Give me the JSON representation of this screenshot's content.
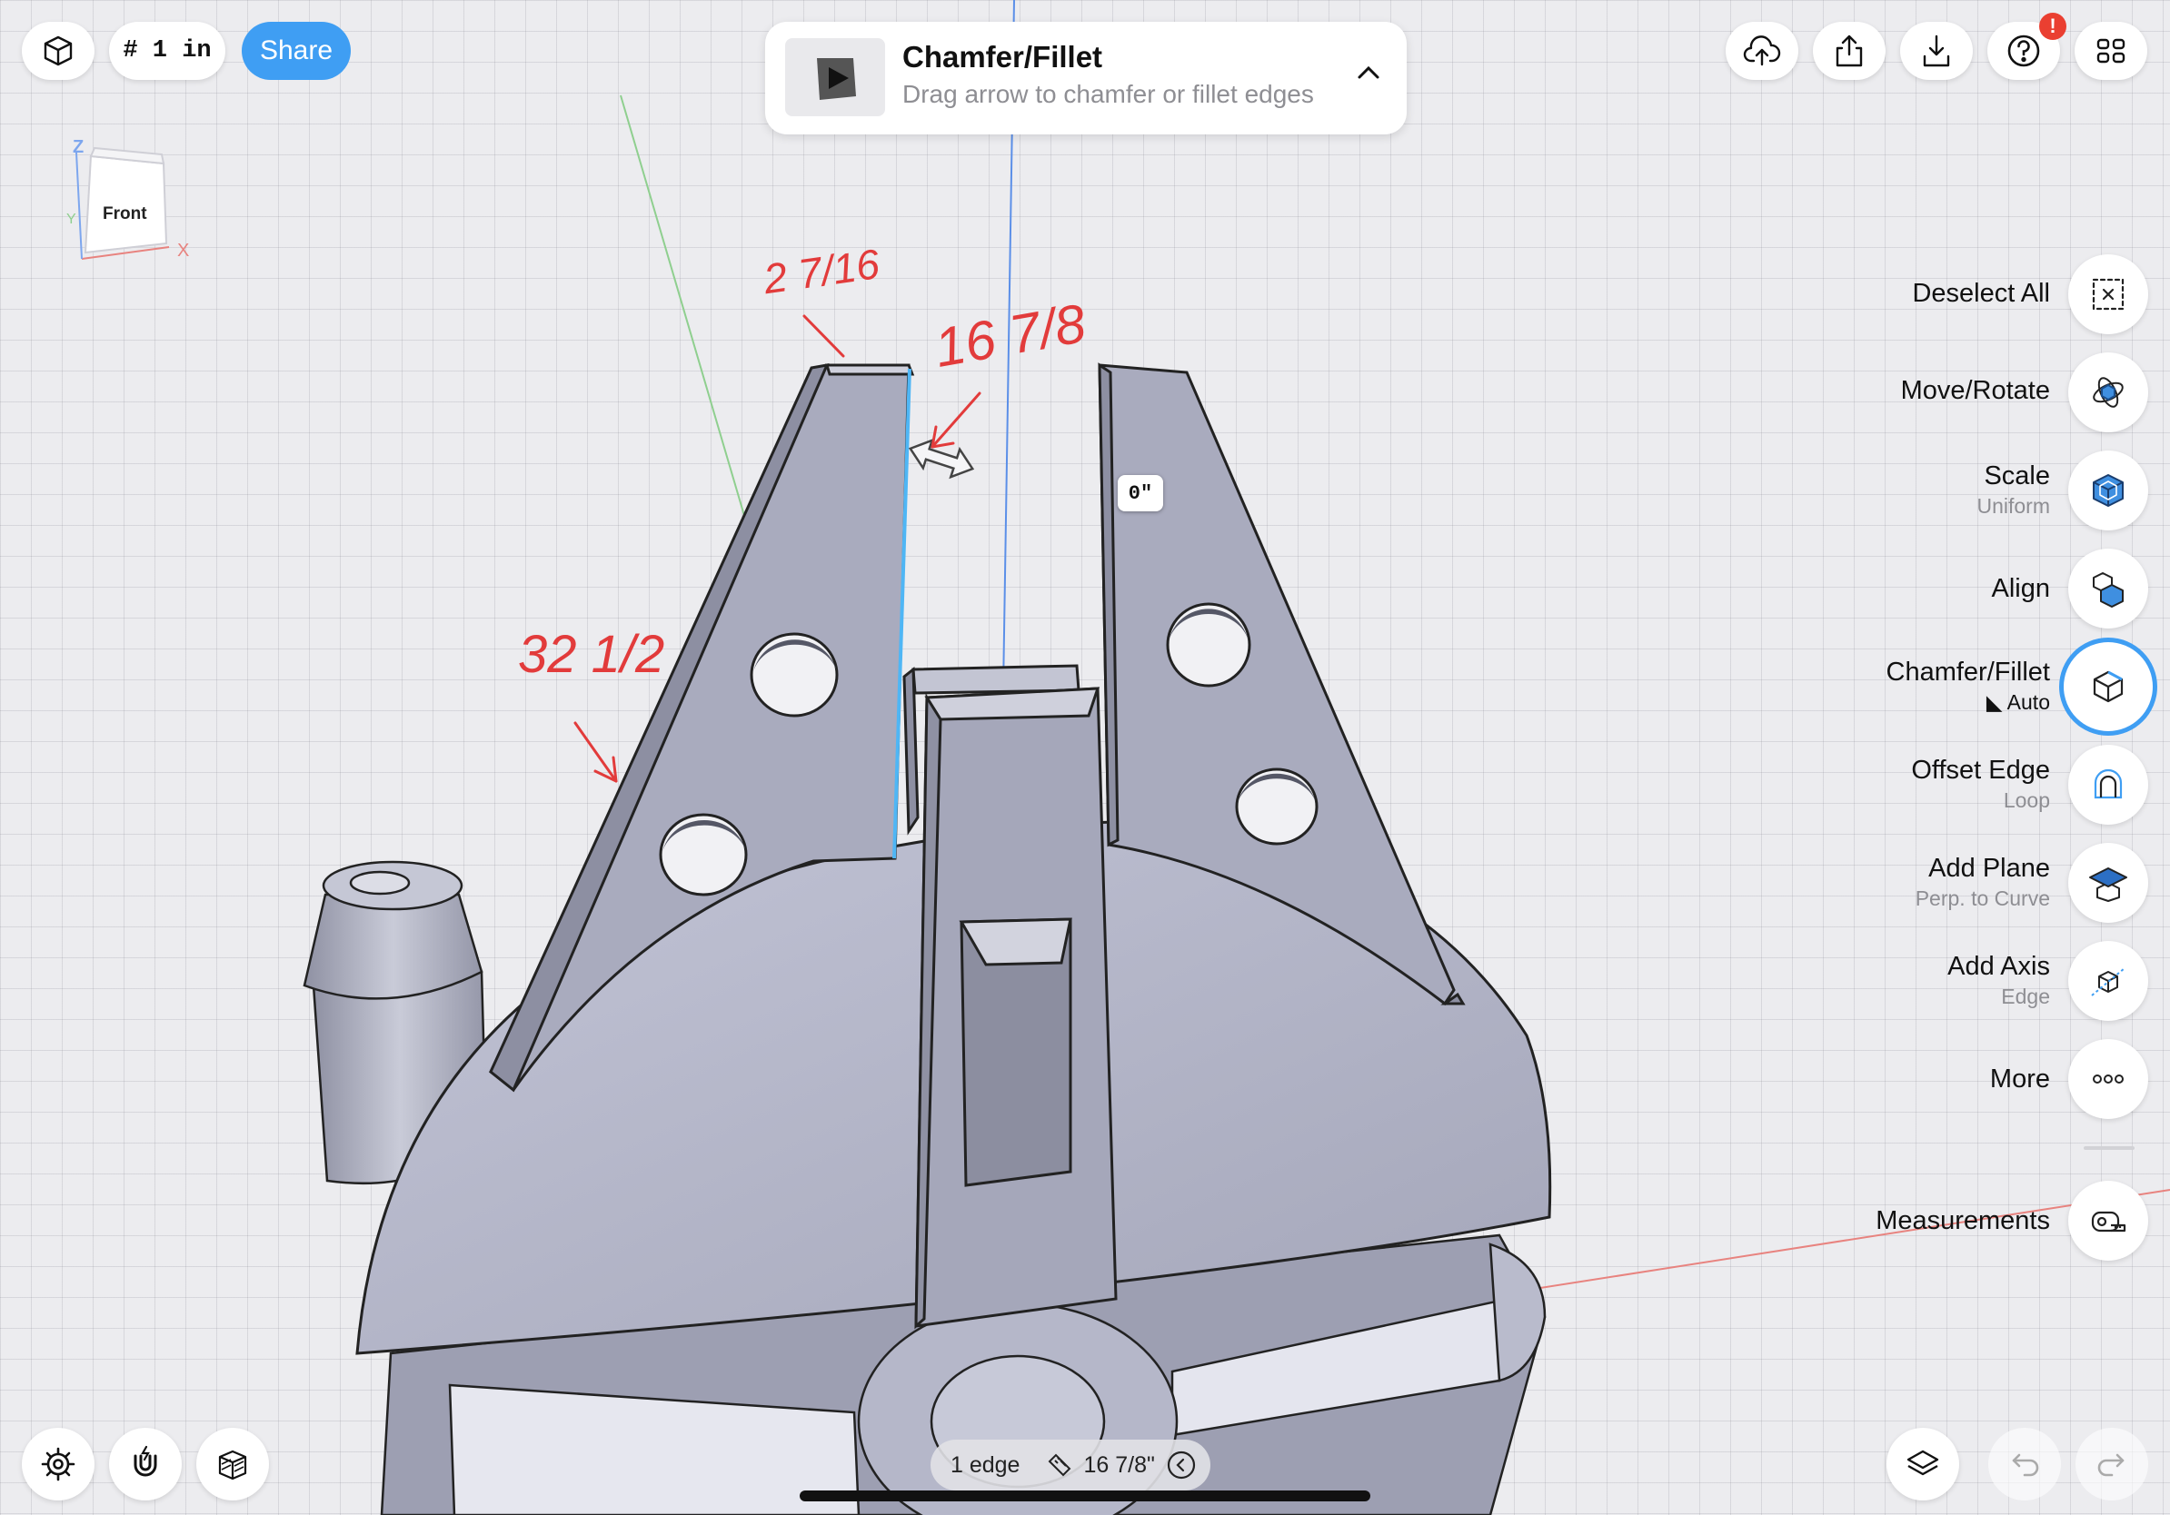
{
  "toolbar": {
    "units_label": "# 1 in",
    "share_label": "Share",
    "notification_badge": "!"
  },
  "banner": {
    "title": "Chamfer/Fillet",
    "subtitle": "Drag arrow to chamfer or fillet edges"
  },
  "nav_cube": {
    "face": "Front",
    "axis_z": "Z",
    "axis_x": "X",
    "axis_y": "Y"
  },
  "annotations": [
    "2 7/16",
    "16 7/8",
    "32 1/2"
  ],
  "viewport": {
    "chamfer_value": "0\""
  },
  "tools": [
    {
      "label": "Deselect All",
      "sub": "",
      "icon": "deselect-icon"
    },
    {
      "label": "Move/Rotate",
      "sub": "",
      "icon": "move-rotate-icon"
    },
    {
      "label": "Scale",
      "sub": "Uniform",
      "icon": "scale-cube-icon"
    },
    {
      "label": "Align",
      "sub": "",
      "icon": "align-icon"
    },
    {
      "label": "Chamfer/Fillet",
      "sub": "Auto",
      "icon": "chamfer-icon"
    },
    {
      "label": "Offset Edge",
      "sub": "Loop",
      "icon": "offset-edge-icon"
    },
    {
      "label": "Add Plane",
      "sub": "Perp. to Curve",
      "icon": "add-plane-icon"
    },
    {
      "label": "Add Axis",
      "sub": "Edge",
      "icon": "add-axis-icon"
    },
    {
      "label": "More",
      "sub": "",
      "icon": "more-icon"
    },
    {
      "label": "Measurements",
      "sub": "",
      "icon": "tape-measure-icon"
    }
  ],
  "status": {
    "selection": "1 edge",
    "measure": "16 7/8\""
  },
  "colors": {
    "accent": "#3f9ef3",
    "model": "#a7a9bb",
    "annotation": "#e23b3b",
    "badge": "#ea3f31"
  }
}
